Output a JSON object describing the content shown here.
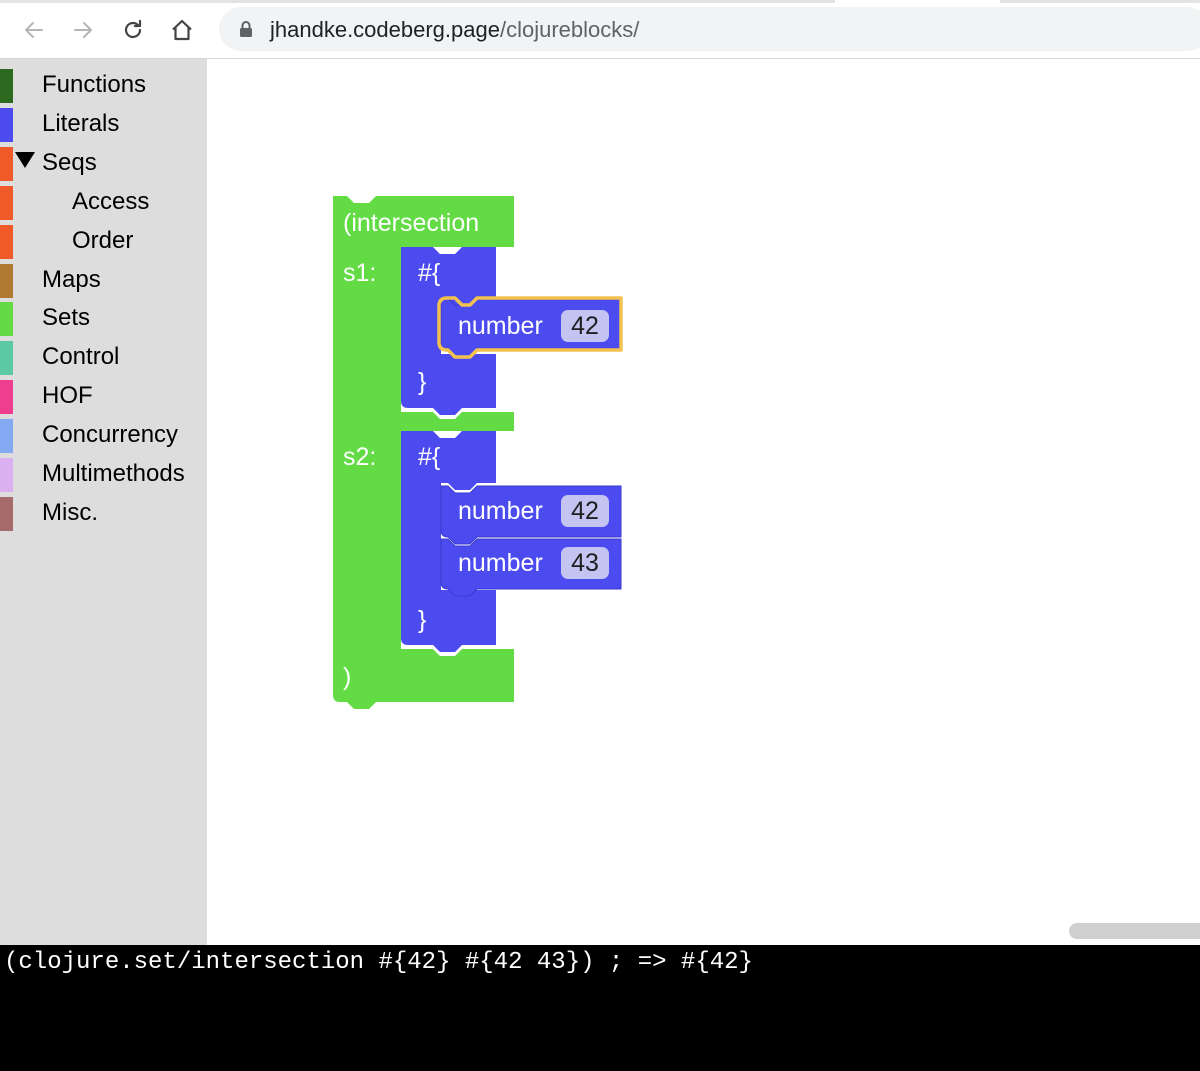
{
  "browser": {
    "url_host": "jhandke.codeberg.page",
    "url_path": "/clojureblocks/",
    "icons": [
      "back-arrow-icon",
      "forward-arrow-icon",
      "reload-icon",
      "home-icon",
      "lock-icon"
    ]
  },
  "sidebar": {
    "categories": [
      {
        "label": "Functions",
        "color": "#2d6a1f",
        "indent": false,
        "expanded": false
      },
      {
        "label": "Literals",
        "color": "#4b4bef",
        "indent": false,
        "expanded": false
      },
      {
        "label": "Seqs",
        "color": "#f05a29",
        "indent": false,
        "expanded": true
      },
      {
        "label": "Access",
        "color": "#f05a29",
        "indent": true,
        "expanded": false
      },
      {
        "label": "Order",
        "color": "#f05a29",
        "indent": true,
        "expanded": false
      },
      {
        "label": "Maps",
        "color": "#b07a30",
        "indent": false,
        "expanded": false
      },
      {
        "label": "Sets",
        "color": "#62db45",
        "indent": false,
        "expanded": false
      },
      {
        "label": "Control",
        "color": "#5cc9a5",
        "indent": false,
        "expanded": false
      },
      {
        "label": "HOF",
        "color": "#ef3e8e",
        "indent": false,
        "expanded": false
      },
      {
        "label": "Concurrency",
        "color": "#85a9f2",
        "indent": false,
        "expanded": false
      },
      {
        "label": "Multimethods",
        "color": "#dbb0f0",
        "indent": false,
        "expanded": false
      },
      {
        "label": "Misc.",
        "color": "#a66a6a",
        "indent": false,
        "expanded": false
      }
    ]
  },
  "workspace": {
    "colors": {
      "set_block": "#62db45",
      "literal_block": "#4b4bef",
      "selection": "#f2c14e",
      "field": "#c4c4f2"
    },
    "intersection": {
      "open_label": "(intersection",
      "close_label": ")",
      "s1_label": "s1:",
      "s2_label": "s2:"
    },
    "set1": {
      "open": "#{",
      "close": "}",
      "items": [
        {
          "label": "number",
          "value": "42",
          "selected": true
        }
      ]
    },
    "set2": {
      "open": "#{",
      "close": "}",
      "items": [
        {
          "label": "number",
          "value": "42",
          "selected": false
        },
        {
          "label": "number",
          "value": "43",
          "selected": false
        }
      ]
    }
  },
  "console": {
    "output": "(clojure.set/intersection #{42} #{42 43}) ; => #{42}"
  }
}
